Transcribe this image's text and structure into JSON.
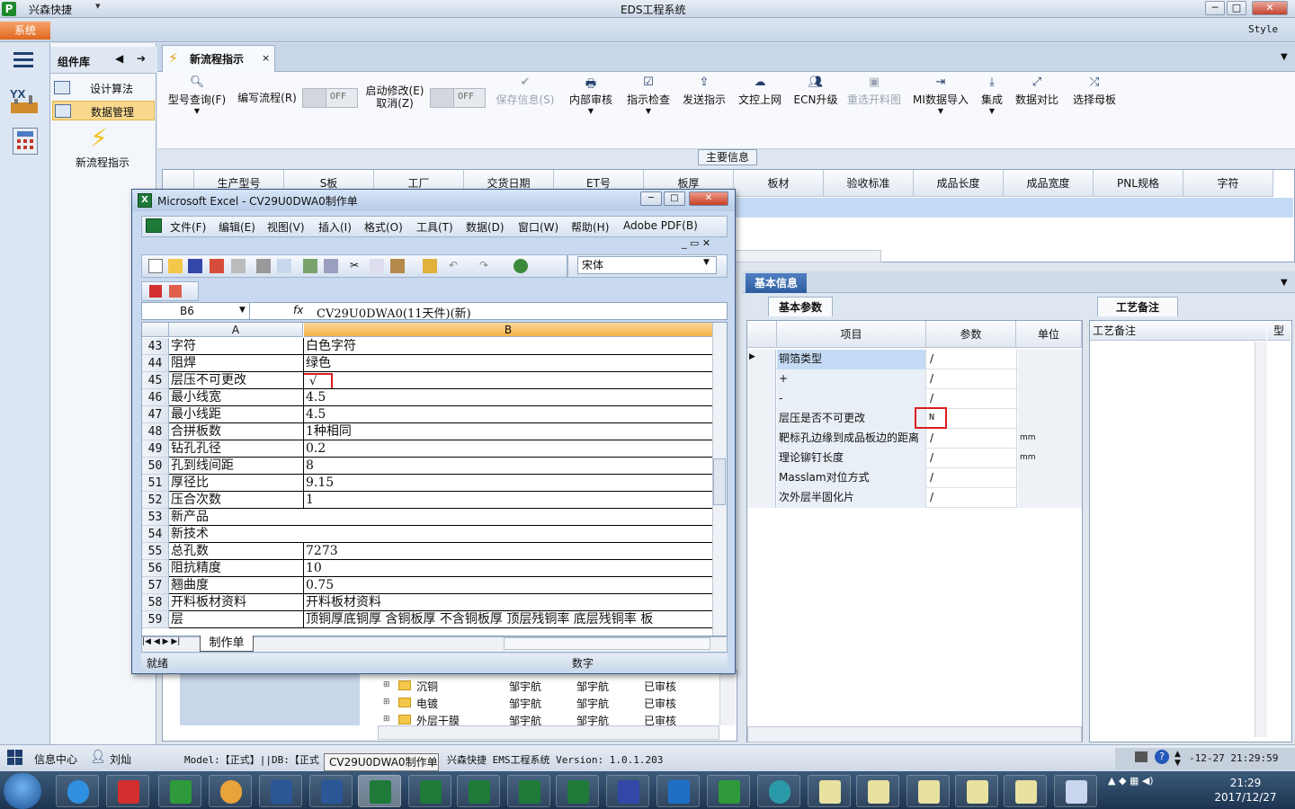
{
  "app": {
    "company": "兴森快捷",
    "title": "EDS工程系统",
    "system_button": "系统",
    "style_label": "Style",
    "window_controls": [
      "─",
      "□",
      "✕"
    ]
  },
  "components": {
    "header": "组件库",
    "items": [
      "设计算法",
      "数据管理"
    ],
    "new_flow_label": "新流程指示"
  },
  "tab": {
    "label": "新流程指示",
    "close": "×"
  },
  "toolbar": {
    "model_query": "型号查询(F)",
    "write_flow": "编写流程(R)",
    "off1": "OFF",
    "start_modify_1": "启动修改(E)",
    "start_modify_2": "取消(Z)",
    "off2": "OFF",
    "save": "保存信息(S)",
    "internal_review": "内部审核",
    "instruction_check": "指示检查",
    "send_instruction": "发送指示",
    "doc_upload": "文控上网",
    "ecn_upgrade": "ECN升级",
    "redraw": "重选开料图",
    "mi_import": "MI数据导入",
    "integrate": "集成",
    "data_compare": "数据对比",
    "select_master": "选择母板"
  },
  "main_info": {
    "label": "主要信息",
    "columns": [
      "生产型号",
      "S板",
      "工厂",
      "交货日期",
      "ET号",
      "板厚",
      "板材",
      "验收标准",
      "成品长度",
      "成品宽度",
      "PNL规格",
      "字符"
    ]
  },
  "basic_info": {
    "tab": "基本信息",
    "subtab": "基本参数",
    "columns": [
      "项目",
      "参数",
      "单位"
    ],
    "rows": [
      {
        "item": "铜箔类型",
        "param": "/",
        "unit": ""
      },
      {
        "item": "+",
        "param": "/",
        "unit": ""
      },
      {
        "item": "-",
        "param": "/",
        "unit": ""
      },
      {
        "item": "层压是否不可更改",
        "param": "N",
        "unit": ""
      },
      {
        "item": "靶标孔边缘到成品板边的距离",
        "param": "/",
        "unit": "mm"
      },
      {
        "item": "理论铆钉长度",
        "param": "/",
        "unit": "mm"
      },
      {
        "item": "Masslam对位方式",
        "param": "/",
        "unit": ""
      },
      {
        "item": "次外层半固化片",
        "param": "/",
        "unit": ""
      }
    ]
  },
  "craft_notes": {
    "tab": "工艺备注",
    "header": "工艺备注",
    "header2": "型"
  },
  "tree": {
    "rows": [
      {
        "name": "沉铜",
        "a": "邹宇航",
        "b": "邹宇航",
        "status": "已审核"
      },
      {
        "name": "电镀",
        "a": "邹宇航",
        "b": "邹宇航",
        "status": "已审核"
      },
      {
        "name": "外层干膜",
        "a": "邹宇航",
        "b": "邹宇航",
        "status": "已审核"
      }
    ]
  },
  "statusbar": {
    "info_center": "信息中心",
    "user": "刘灿",
    "model": "Model:【正式】||DB:【正式",
    "tooltip": "CV29U0DWA0制作单",
    "app_info": "兴森快捷 EMS工程系统 Version: 1.0.1.203",
    "datetime": "-12-27 21:29:59"
  },
  "excel": {
    "title": "Microsoft Excel - CV29U0DWA0制作单",
    "menu": [
      "文件(F)",
      "编辑(E)",
      "视图(V)",
      "插入(I)",
      "格式(O)",
      "工具(T)",
      "数据(D)",
      "窗口(W)",
      "帮助(H)",
      "Adobe PDF(B)"
    ],
    "font": "宋体",
    "name_box": "B6",
    "fx": "fx",
    "formula": "CV29U0DWA0(11天件)(新)",
    "col_a": "A",
    "col_b": "B",
    "rows": [
      {
        "n": "43",
        "a": "字符",
        "b": "白色字符"
      },
      {
        "n": "44",
        "a": "阻焊",
        "b": "绿色"
      },
      {
        "n": "45",
        "a": "层压不可更改",
        "b": "√"
      },
      {
        "n": "46",
        "a": "最小线宽",
        "b": "4.5"
      },
      {
        "n": "47",
        "a": "最小线距",
        "b": "4.5"
      },
      {
        "n": "48",
        "a": "合拼板数",
        "b": "1种相同"
      },
      {
        "n": "49",
        "a": "钻孔孔径",
        "b": "0.2"
      },
      {
        "n": "50",
        "a": "孔到线间距",
        "b": "8"
      },
      {
        "n": "51",
        "a": "厚径比",
        "b": "9.15"
      },
      {
        "n": "52",
        "a": "压合次数",
        "b": "1"
      },
      {
        "n": "53",
        "merged": "新产品"
      },
      {
        "n": "54",
        "merged": "新技术"
      },
      {
        "n": "55",
        "a": "总孔数",
        "b": "7273"
      },
      {
        "n": "56",
        "a": "阻抗精度",
        "b": "10"
      },
      {
        "n": "57",
        "a": "翘曲度",
        "b": "0.75"
      },
      {
        "n": "58",
        "a": "开料板材资料",
        "b": "开料板材资料"
      },
      {
        "n": "59",
        "a": "层",
        "b": "顶铜厚底铜厚 含铜板厚 不含铜板厚 顶层残铜率 底层残铜率 板"
      }
    ],
    "sheet_tab": "制作单",
    "status_ready": "就绪",
    "status_num": "数字"
  },
  "taskbar": {
    "time": "21:29",
    "date": "2017/12/27"
  }
}
